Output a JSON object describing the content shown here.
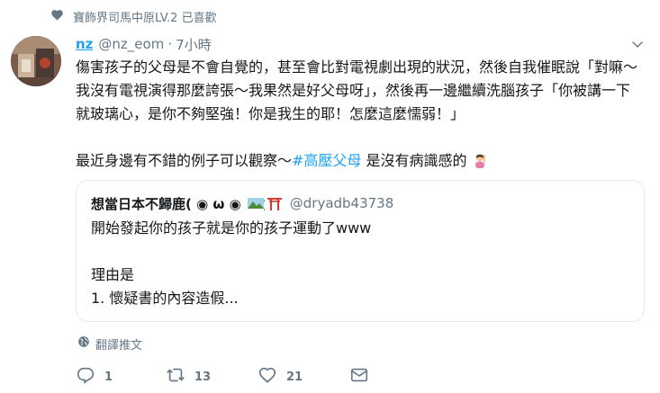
{
  "social_context": {
    "text": "寶飾界司馬中原LV.2 已喜歡",
    "icon": "heart-icon"
  },
  "tweet": {
    "display_name": "nz",
    "handle": "@nz_eom",
    "separator": "·",
    "time": "7小時",
    "paragraphs": [
      "傷害孩子的父母是不會自覺的，甚至會比對電視劇出現的狀況，然後自我催眠說「對嘛～我沒有電視演得那麼誇張～我果然是好父母呀」，然後再一邊繼續洗腦孩子「你被講一下就玻璃心，是你不夠堅強！你是我生的耶！怎麼這麼懦弱！」"
    ],
    "line2_prefix": "最近身邊有不錯的例子可以觀察～",
    "hashtag": "#高壓父母",
    "line2_suffix": " 是沒有病識感的"
  },
  "quote": {
    "name": "想當日本不歸鹿( ◉ ω ◉",
    "handle": "@dryadb43738",
    "lines": [
      "開始發起你的孩子就是你的孩子運動了www",
      "",
      "理由是",
      "1. 懷疑書的內容造假..."
    ]
  },
  "translate_label": "翻譯推文",
  "actions": {
    "reply_count": "1",
    "retweet_count": "13",
    "like_count": "21"
  },
  "colors": {
    "accent": "#1da1f2",
    "secondary_text": "#657786",
    "border": "#e1e8ed"
  }
}
